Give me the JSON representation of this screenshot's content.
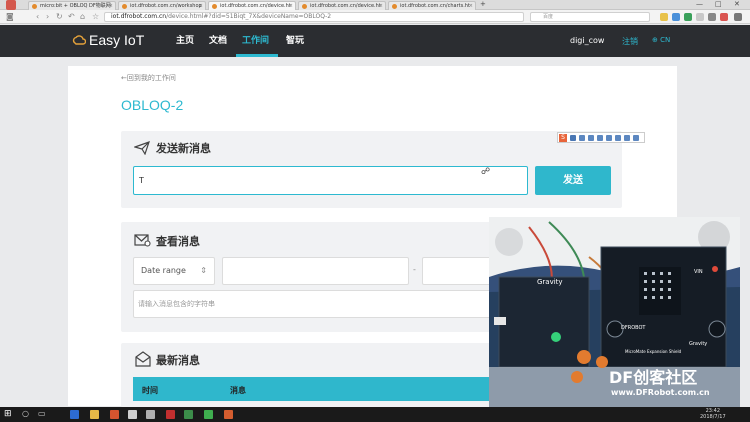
{
  "browser": {
    "tabs": [
      {
        "label": "micro:bit + OBLOQ DF物联网"
      },
      {
        "label": "iot.dfrobot.com.cn/workshop"
      },
      {
        "label": "iot.dfrobot.com.cn/device.ht"
      },
      {
        "label": "iot.dfrobot.com.cn/device.ht"
      },
      {
        "label": "iot.dfrobot.com.cn/charts.ht"
      }
    ],
    "new_tab": "+",
    "url_host": "iot.dfrobot.com.cn",
    "url_rest": "/device.html#?did=51Biqt_7X&deviceName=OBLOQ-2",
    "search_placeholder": "百度",
    "window_controls": [
      "—",
      "□",
      "✕"
    ]
  },
  "header": {
    "logo": "Easy IoT",
    "nav": [
      "主页",
      "文档",
      "工作间",
      "智玩"
    ],
    "active_nav_index": 2,
    "username": "digi_cow",
    "logout": "注销",
    "lang": "CN"
  },
  "page": {
    "back_link": "←回到我的工作间",
    "device_name": "OBLOQ-2"
  },
  "send_card": {
    "title": "发送新消息",
    "input_value": "T",
    "send_label": "发送"
  },
  "view_card": {
    "title": "查看消息",
    "date_range": "Date range",
    "dash": "-",
    "filter_placeholder": "请输入消息包含的字符串"
  },
  "latest_card": {
    "title": "最新消息",
    "columns": [
      "时间",
      "消息"
    ]
  },
  "video_overlay": {
    "board_labels": [
      "Gravity",
      "DFROBOT",
      "MicroMate Expansion Shield",
      "VIN",
      "Gravity"
    ],
    "watermark": "DF创客社区",
    "watermark_url": "www.DFRobot.com.cn"
  },
  "taskbar": {
    "time": "23:42",
    "date": "2018/7/17"
  },
  "colors": {
    "accent": "#2db9d0",
    "header_bg": "#2b2d31"
  }
}
